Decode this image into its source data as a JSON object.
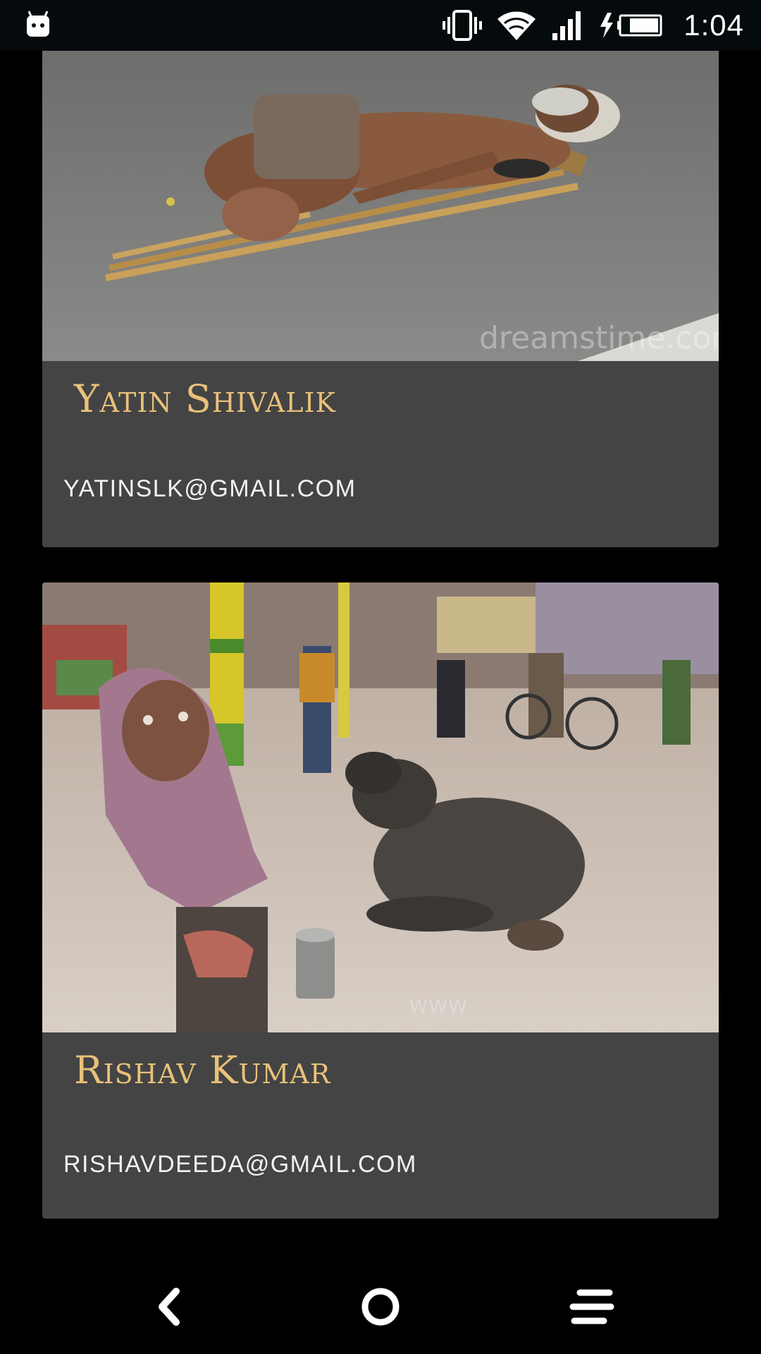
{
  "status_bar": {
    "time": "1:04",
    "icons": [
      "android-notification-icon",
      "vibrate-icon",
      "wifi-icon",
      "signal-icon",
      "battery-charging-icon"
    ]
  },
  "cards": [
    {
      "name": "Yatin Shivalik",
      "email": "YATINSLK@GMAIL.COM",
      "photo": "man-lying-on-road-with-crutches",
      "watermark": "dreamstime.com"
    },
    {
      "name": "Rishav Kumar",
      "email": "RISHAVDEEDA@GMAIL.COM",
      "photo": "child-begging-on-street-with-cow"
    }
  ],
  "nav_bar": {
    "buttons": [
      "back-icon",
      "home-icon",
      "recents-icon"
    ]
  },
  "colors": {
    "card_background": "#444444",
    "name_color": "#e8c17a",
    "email_color": "#f2f2f2",
    "page_background": "#000000"
  }
}
